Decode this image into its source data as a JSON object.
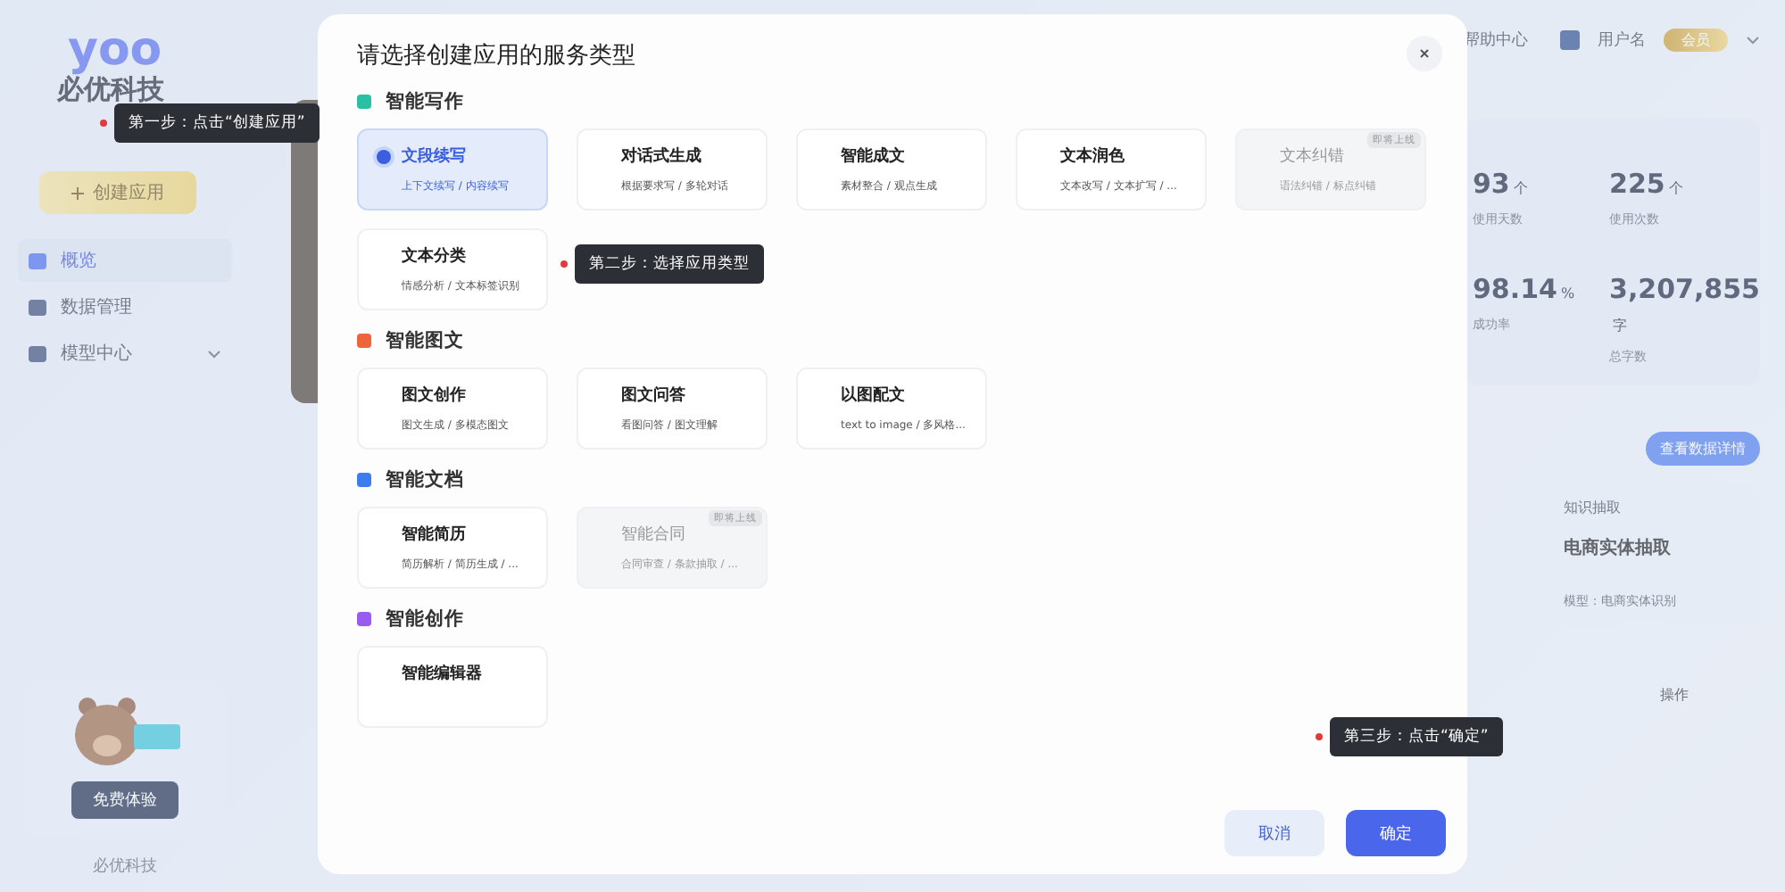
{
  "sidebar": {
    "logo": "yoo",
    "brand": "必优科技",
    "create_button": "创建应用",
    "items": [
      {
        "label": "概览",
        "selected": true,
        "expandable": false
      },
      {
        "label": "数据管理",
        "selected": false,
        "expandable": false
      },
      {
        "label": "模型中心",
        "selected": false,
        "expandable": true
      }
    ],
    "promo": {
      "button": "免费体验"
    },
    "footer": "必优科技"
  },
  "header": {
    "link": "帮助中心",
    "user": "用户名",
    "badge": "会员"
  },
  "stats": [
    {
      "value": "93",
      "unit": "个",
      "label": "使用天数"
    },
    {
      "value": "225",
      "unit": "个",
      "label": "使用次数"
    },
    {
      "value": "98.14",
      "unit": "%",
      "label": "成功率"
    },
    {
      "value": "3,207,855",
      "unit": "字",
      "label": "总字数"
    }
  ],
  "stats_button": "查看数据详情",
  "task_card": {
    "tag": "知识抽取",
    "title": "电商实体抽取",
    "model": "模型：电商实体识别"
  },
  "table_header": "操作",
  "dialog": {
    "title": "请选择创建应用的服务类型",
    "sections": [
      {
        "title": "智能写作",
        "color": "#2bbfa4",
        "cards": [
          {
            "title": "文段续写",
            "desc": "上下文续写 / 内容续写",
            "selected": true,
            "disabled": false
          },
          {
            "title": "对话式生成",
            "desc": "根据要求写 / 多轮对话",
            "selected": false,
            "disabled": false
          },
          {
            "title": "智能成文",
            "desc": "素材整合 / 观点生成",
            "selected": false,
            "disabled": false
          },
          {
            "title": "文本润色",
            "desc": "文本改写 / 文本扩写 / ...",
            "selected": false,
            "disabled": false
          },
          {
            "title": "文本纠错",
            "desc": "语法纠错 / 标点纠错",
            "selected": false,
            "disabled": true,
            "badge": "即将上线"
          },
          {
            "title": "文本分类",
            "desc": "情感分析 / 文本标签识别",
            "selected": false,
            "disabled": false
          }
        ]
      },
      {
        "title": "智能图文",
        "color": "#f0643c",
        "cards": [
          {
            "title": "图文创作",
            "desc": "图文生成 / 多模态图文",
            "selected": false,
            "disabled": false
          },
          {
            "title": "图文问答",
            "desc": "看图问答 / 图文理解",
            "selected": false,
            "disabled": false
          },
          {
            "title": "以图配文",
            "desc": "text to image / 多风格...",
            "selected": false,
            "disabled": false
          }
        ]
      },
      {
        "title": "智能文档",
        "color": "#3b7cf0",
        "cards": [
          {
            "title": "智能简历",
            "desc": "简历解析 / 简历生成 / ...",
            "selected": false,
            "disabled": false
          },
          {
            "title": "智能合同",
            "desc": "合同审查 / 条款抽取 / ...",
            "selected": false,
            "disabled": true,
            "badge": "即将上线"
          }
        ]
      },
      {
        "title": "智能创作",
        "color": "#9a5cf0",
        "cards": [
          {
            "title": "智能编辑器",
            "selected": false,
            "disabled": false
          }
        ]
      }
    ],
    "cancel": "取消",
    "confirm": "确定"
  },
  "tips": [
    "第一步：点击“创建应用”",
    "第二步：选择应用类型",
    "第三步：点击“确定”"
  ]
}
